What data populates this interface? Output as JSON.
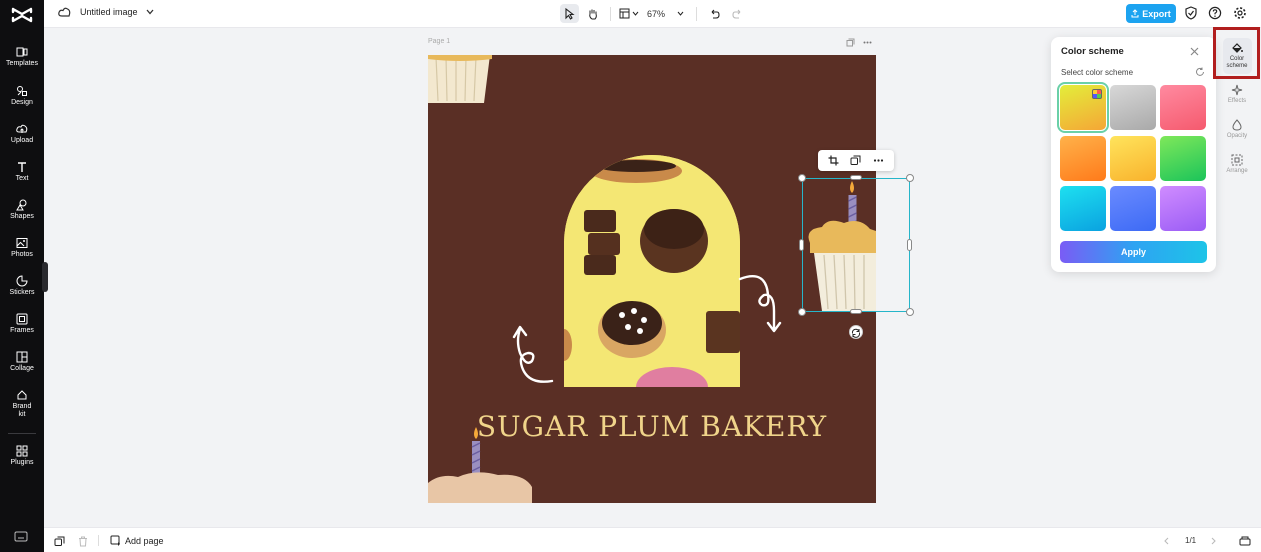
{
  "app": {
    "name": "CapCut"
  },
  "rail": {
    "items": [
      {
        "label": "Templates",
        "icon": "templates-icon"
      },
      {
        "label": "Design",
        "icon": "design-icon"
      },
      {
        "label": "Upload",
        "icon": "upload-icon"
      },
      {
        "label": "Text",
        "icon": "text-icon"
      },
      {
        "label": "Shapes",
        "icon": "shapes-icon"
      },
      {
        "label": "Photos",
        "icon": "photos-icon"
      },
      {
        "label": "Stickers",
        "icon": "stickers-icon"
      },
      {
        "label": "Frames",
        "icon": "frames-icon"
      },
      {
        "label": "Collage",
        "icon": "collage-icon"
      },
      {
        "label": "Brand kit",
        "icon": "brand-kit-icon"
      },
      {
        "label": "Plugins",
        "icon": "plugins-icon"
      }
    ]
  },
  "topbar": {
    "title": "Untitled image",
    "zoom": "67%",
    "export_label": "Export"
  },
  "canvas": {
    "page_label": "Page 1",
    "design_title": "SUGAR PLUM BAKERY",
    "background_color": "#5a2f25"
  },
  "color_scheme_panel": {
    "title": "Color scheme",
    "subtitle": "Select color scheme",
    "apply_label": "Apply",
    "selected_index": 0,
    "swatches": [
      {
        "name": "yellow-orange",
        "from": "#e3ee3a",
        "to": "#f5a636"
      },
      {
        "name": "gray",
        "from": "#d8d8d8",
        "to": "#a9a9a9"
      },
      {
        "name": "pink",
        "from": "#ff8aa0",
        "to": "#f55a6e"
      },
      {
        "name": "orange",
        "from": "#ffb24a",
        "to": "#ff7a1a"
      },
      {
        "name": "yellow",
        "from": "#ffe45c",
        "to": "#f9b22c"
      },
      {
        "name": "green",
        "from": "#7fe85a",
        "to": "#1bc45a"
      },
      {
        "name": "cyan",
        "from": "#1ee0f0",
        "to": "#0aa2e0"
      },
      {
        "name": "blue",
        "from": "#6a8bff",
        "to": "#3d6af5"
      },
      {
        "name": "purple",
        "from": "#d08cff",
        "to": "#9a5cf5"
      }
    ]
  },
  "properties_rail": {
    "items": [
      {
        "label": "Color scheme",
        "icon": "paint-bucket-icon"
      },
      {
        "label": "Effects",
        "icon": "effects-icon"
      },
      {
        "label": "Opacity",
        "icon": "opacity-icon"
      },
      {
        "label": "Arrange",
        "icon": "arrange-icon"
      }
    ]
  },
  "bottombar": {
    "add_page_label": "Add page",
    "page_count": "1/1"
  }
}
